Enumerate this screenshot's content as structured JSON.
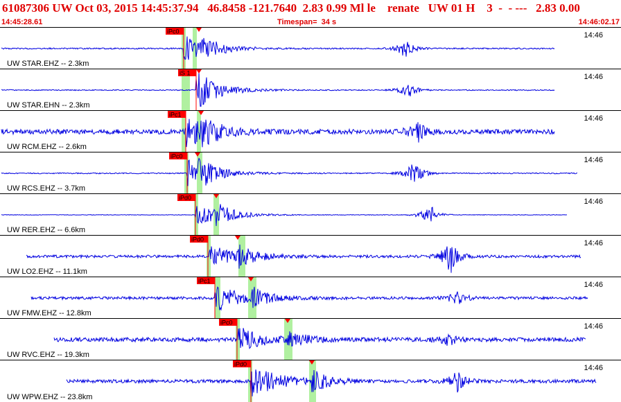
{
  "header": {
    "title": "61087306 UW Oct 03, 2015 14:45:37.94   46.8458 -121.7640  2.83 0.99 Ml le    renate   UW 01 H    3  -  - ---   2.83 0.00",
    "start_time": "14:45:28.61",
    "timespan": "Timespan=  34 s",
    "end_time": "14:46:02.17"
  },
  "colors": {
    "trace": "#0000e0",
    "pick": "#ff0000",
    "window": "#b0f0a0",
    "header_text": "#e00000"
  },
  "channels": [
    {
      "label": "UW STAR.EHZ -- 2.3km",
      "time": "14:46",
      "pick": "iPc0"
    },
    {
      "label": "UW STAR.EHN -- 2.3km",
      "time": "14:46",
      "pick": "iS 1"
    },
    {
      "label": "UW RCM.EHZ -- 2.6km",
      "time": "14:46",
      "pick": "iPc1"
    },
    {
      "label": "UW RCS.EHZ -- 3.7km",
      "time": "14:46",
      "pick": "iPc0"
    },
    {
      "label": "UW RER.EHZ -- 6.6km",
      "time": "14:46",
      "pick": "iPd0"
    },
    {
      "label": "UW LO2.EHZ -- 11.1km",
      "time": "14:46",
      "pick": "iPd0"
    },
    {
      "label": "UW FMW.EHZ -- 12.8km",
      "time": "14:46",
      "pick": "iPc1"
    },
    {
      "label": "UW RVC.EHZ -- 19.3km",
      "time": "14:46",
      "pick": "iPc0"
    },
    {
      "label": "UW WPW.EHZ -- 23.8km",
      "time": "14:46",
      "pick": "iPd0"
    }
  ]
}
